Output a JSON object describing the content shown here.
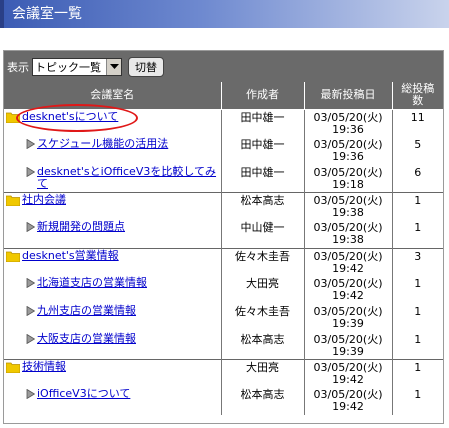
{
  "page_title": "会議室一覧",
  "toolbar": {
    "display_label": "表示",
    "select_value": "トピック一覧",
    "switch_button": "切替"
  },
  "table": {
    "headers": [
      "会議室名",
      "作成者",
      "最新投稿日",
      "総投稿数"
    ],
    "rows": [
      {
        "type": "room",
        "name": "desknet'sについて",
        "author": "田中雄一",
        "date": "03/05/20(火) 19:36",
        "count": "11"
      },
      {
        "type": "topic",
        "name": "スケジュール機能の活用法",
        "author": "田中雄一",
        "date": "03/05/20(火) 19:36",
        "count": "5"
      },
      {
        "type": "topic",
        "name": "desknet'sとiOfficeV3を比較してみて",
        "author": "田中雄一",
        "date": "03/05/20(火) 19:18",
        "count": "6"
      },
      {
        "type": "room",
        "name": "社内会議",
        "author": "松本高志",
        "date": "03/05/20(火) 19:38",
        "count": "1"
      },
      {
        "type": "topic",
        "name": "新規開発の問題点",
        "author": "中山健一",
        "date": "03/05/20(火) 19:38",
        "count": "1"
      },
      {
        "type": "room",
        "name": "desknet's営業情報",
        "author": "佐々木圭吾",
        "date": "03/05/20(火) 19:42",
        "count": "3"
      },
      {
        "type": "topic",
        "name": "北海道支店の営業情報",
        "author": "大田亮",
        "date": "03/05/20(火) 19:42",
        "count": "1"
      },
      {
        "type": "topic",
        "name": "九州支店の営業情報",
        "author": "佐々木圭吾",
        "date": "03/05/20(火) 19:39",
        "count": "1"
      },
      {
        "type": "topic",
        "name": "大阪支店の営業情報",
        "author": "松本高志",
        "date": "03/05/20(火) 19:39",
        "count": "1"
      },
      {
        "type": "room",
        "name": "技術情報",
        "author": "大田亮",
        "date": "03/05/20(火) 19:42",
        "count": "1"
      },
      {
        "type": "topic",
        "name": "iOfficeV3について",
        "author": "松本高志",
        "date": "03/05/20(火) 19:42",
        "count": "1"
      }
    ]
  },
  "colors": {
    "title_bar": "#5a78c8",
    "header_bg": "#6a6a6a",
    "link": "#0000cc",
    "folder": "#f0c800",
    "highlight_circle": "#e01818"
  },
  "icons": {
    "room": "folder-icon",
    "topic": "triangle-right-icon",
    "select": "chevron-down-icon"
  }
}
